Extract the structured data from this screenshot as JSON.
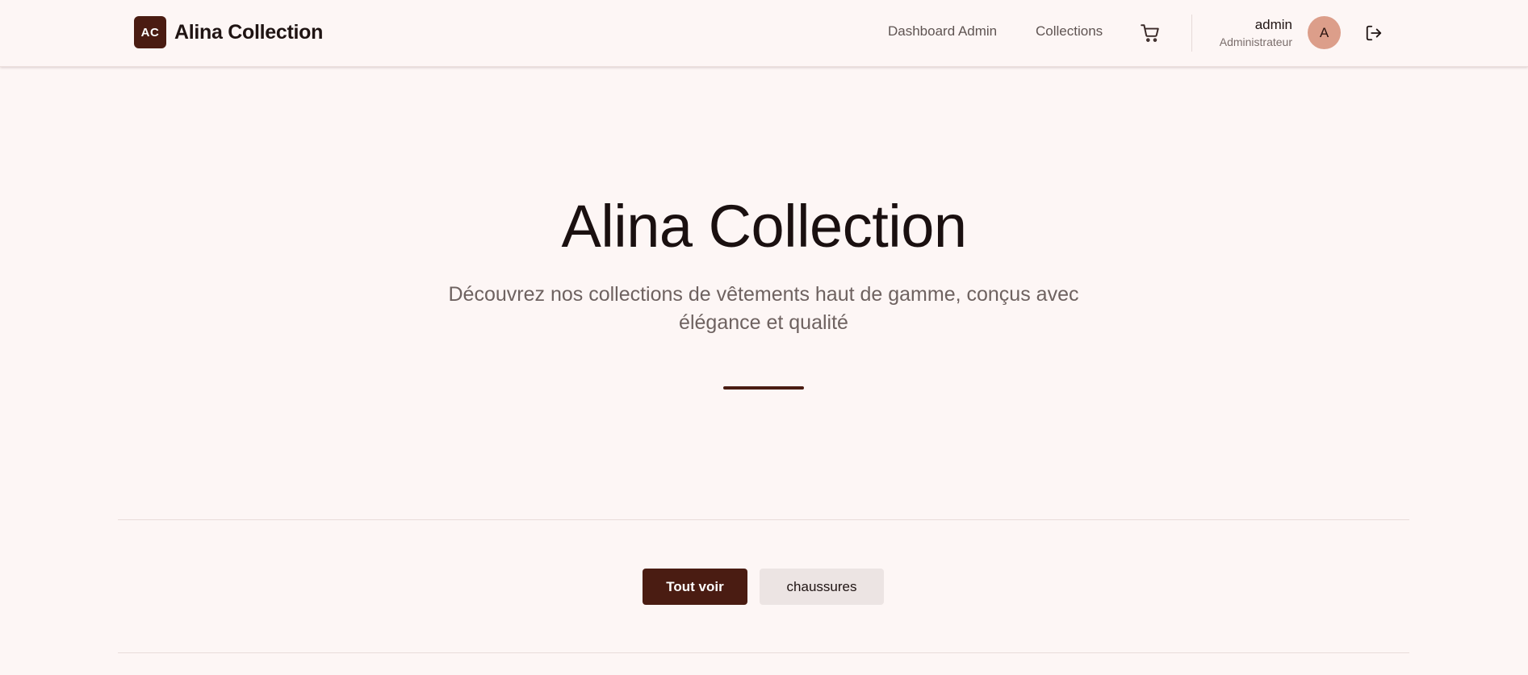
{
  "brand": {
    "logo_initials": "AC",
    "name": "Alina Collection"
  },
  "nav": {
    "links": [
      {
        "label": "Dashboard Admin"
      },
      {
        "label": "Collections"
      }
    ],
    "cart_icon": "shopping-cart-icon",
    "logout_icon": "logout-icon"
  },
  "user": {
    "name": "admin",
    "role": "Administrateur",
    "avatar_initial": "A"
  },
  "hero": {
    "title": "Alina Collection",
    "subtitle": "Découvrez nos collections de vêtements haut de gamme, conçus avec élégance et qualité"
  },
  "filters": [
    {
      "label": "Tout voir",
      "active": true
    },
    {
      "label": "chaussures",
      "active": false
    }
  ],
  "colors": {
    "accent": "#4a1c12",
    "background": "#fdf6f5",
    "avatar": "#dc9e8a",
    "inactive_filter": "#ece4e3"
  }
}
